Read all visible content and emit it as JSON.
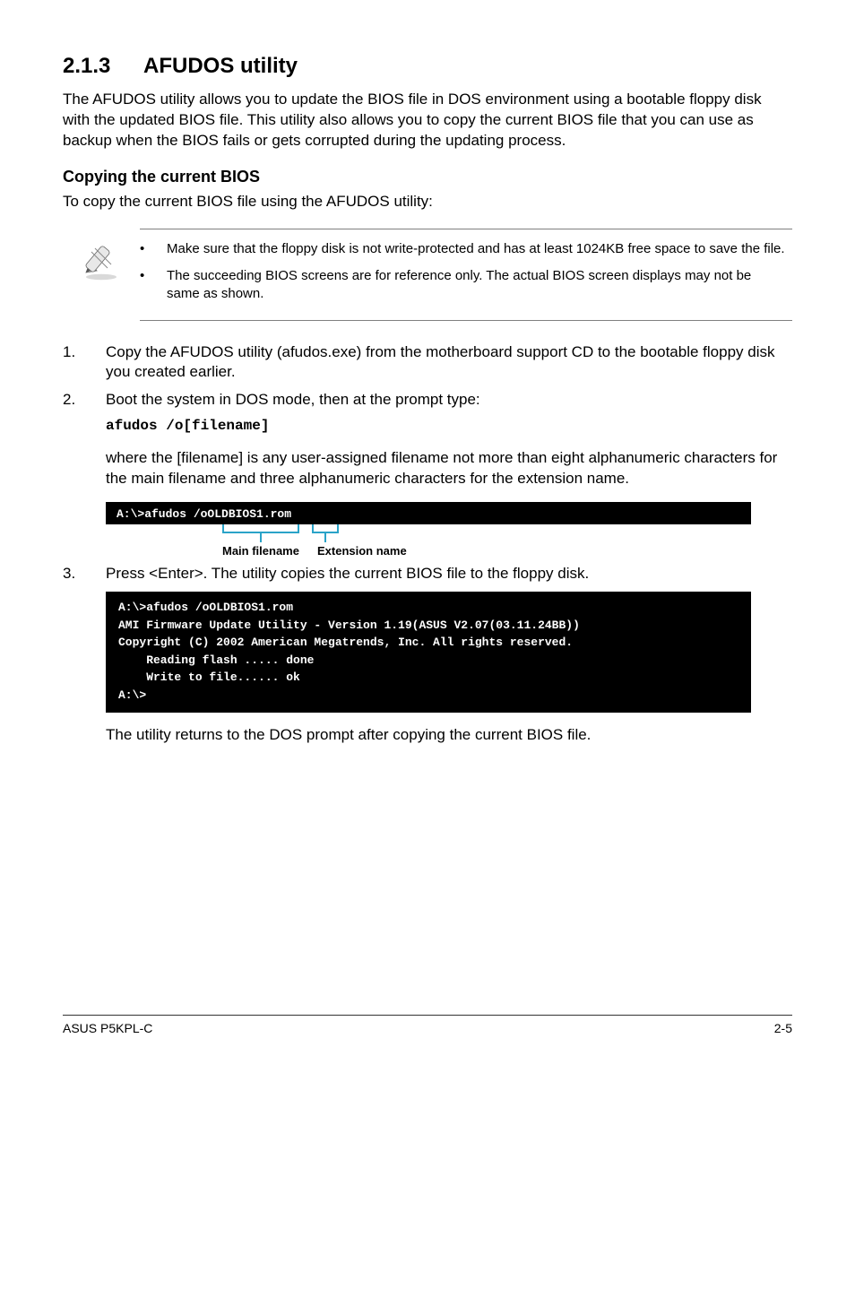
{
  "heading": {
    "num": "2.1.3",
    "title": "AFUDOS utility"
  },
  "intro": "The AFUDOS utility allows you to update the BIOS file in DOS environment using a bootable floppy disk with the updated BIOS file. This utility also allows you to copy the current BIOS file that you can use as backup when the BIOS fails or gets corrupted during the updating process.",
  "subheading": "Copying the current BIOS",
  "subintro": "To copy the current BIOS file using the AFUDOS utility:",
  "notes": [
    "Make sure that the floppy disk is not write-protected and has at least 1024KB free space to save the file.",
    "The succeeding BIOS screens are for reference only. The actual BIOS screen displays may not be same as shown."
  ],
  "steps": {
    "s1": {
      "n": "1.",
      "t": "Copy the AFUDOS utility (afudos.exe) from the motherboard support CD to the bootable floppy disk you created earlier."
    },
    "s2": {
      "n": "2.",
      "t": "Boot the system in DOS mode, then at the prompt type:"
    },
    "code": "afudos /o[filename]",
    "explain": "where the [filename] is any user-assigned filename not more than eight alphanumeric characters for the main filename and three alphanumeric characters for the extension name.",
    "term1": "A:\\>afudos /oOLDBIOS1.rom",
    "anno": {
      "main": "Main filename",
      "ext": "Extension name"
    },
    "s3": {
      "n": "3.",
      "t": "Press <Enter>. The utility copies the current BIOS file to the floppy disk."
    },
    "term2": "A:\\>afudos /oOLDBIOS1.rom\nAMI Firmware Update Utility - Version 1.19(ASUS V2.07(03.11.24BB))\nCopyright (C) 2002 American Megatrends, Inc. All rights reserved.\n    Reading flash ..... done\n    Write to file...... ok\nA:\\>",
    "outro": "The utility returns to the DOS prompt after copying the current BIOS file."
  },
  "footer": {
    "left": "ASUS P5KPL-C",
    "right": "2-5"
  }
}
